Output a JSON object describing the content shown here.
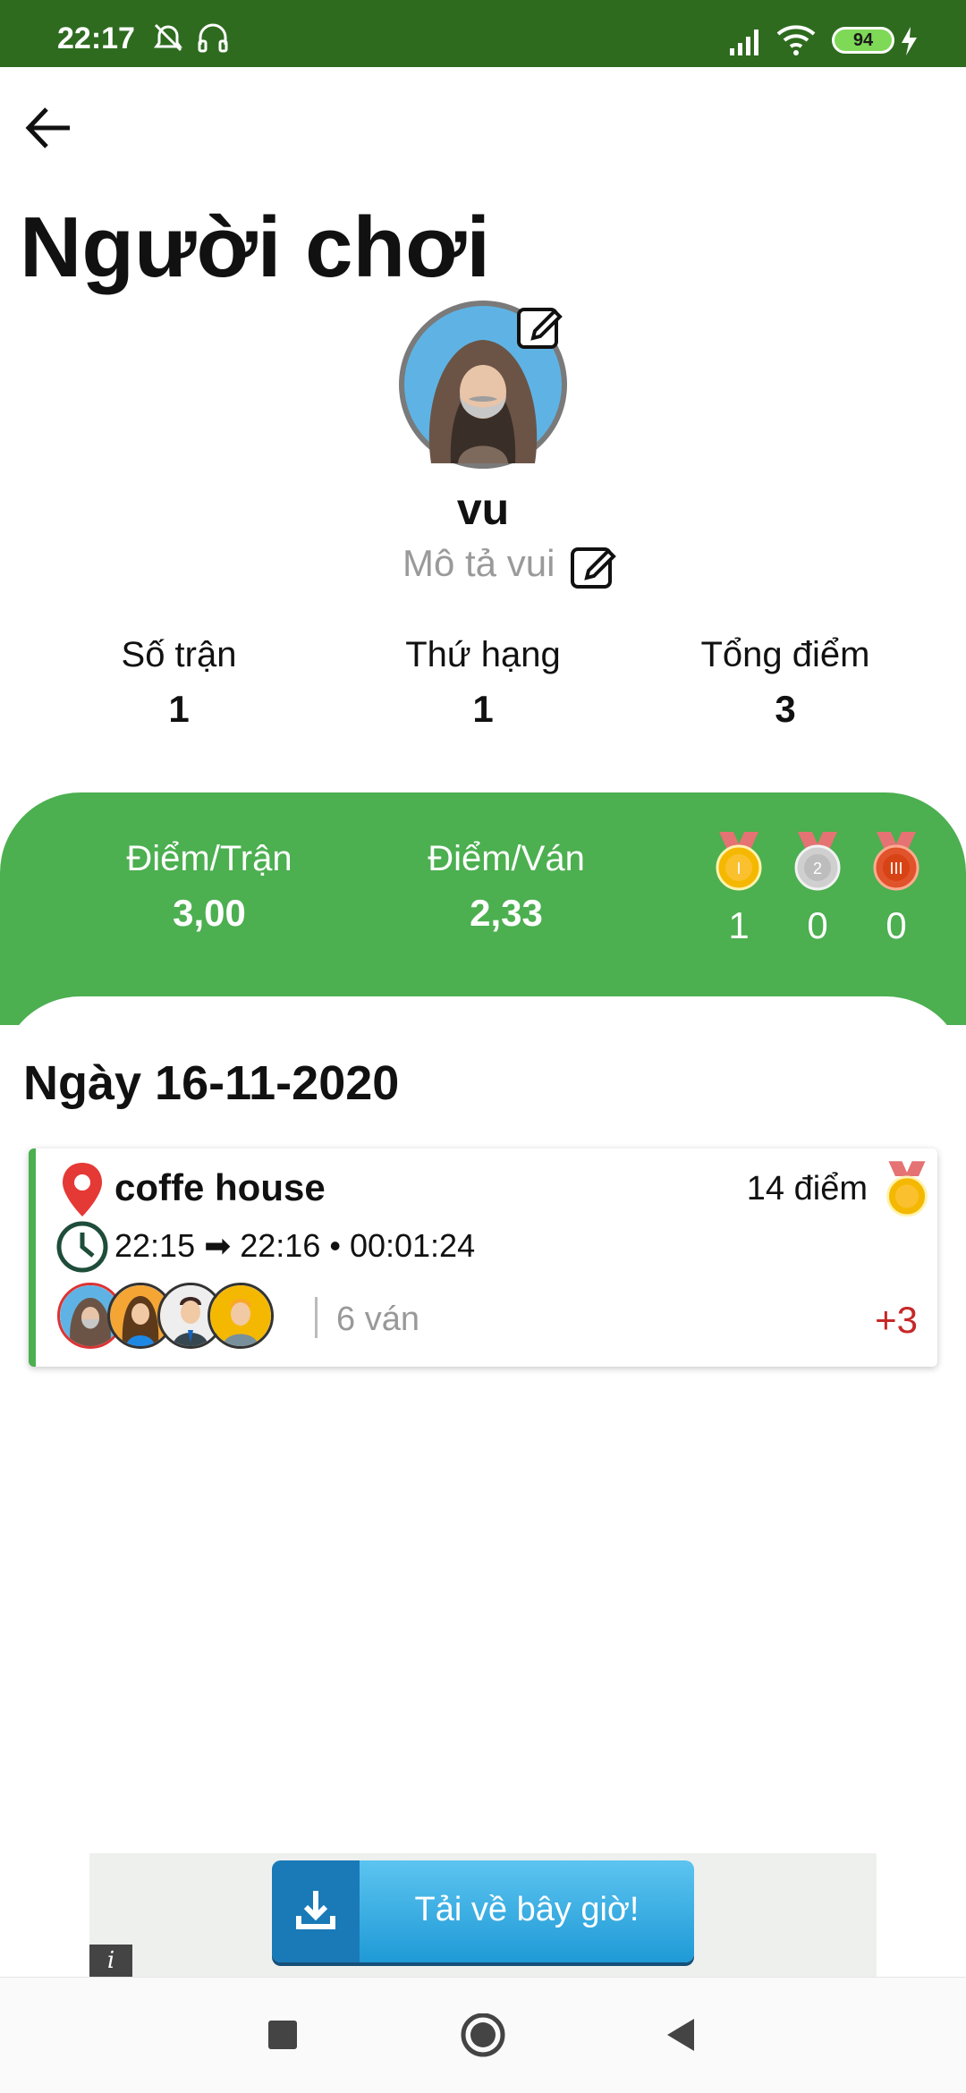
{
  "status_bar": {
    "time": "22:17",
    "battery": "94",
    "icons": [
      "alarm-off-icon",
      "headphones-icon",
      "signal-icon",
      "wifi-icon",
      "battery-icon",
      "charging-icon"
    ]
  },
  "header": {
    "title": "Người chơi",
    "back_icon": "arrow-left-icon"
  },
  "profile": {
    "name": "vu",
    "description": "Mô tả vui",
    "avatar_icon": "hooded-man-avatar",
    "edit_icon": "edit-icon"
  },
  "stats": [
    {
      "label": "Số trận",
      "value": "1"
    },
    {
      "label": "Thứ hạng",
      "value": "1"
    },
    {
      "label": "Tổng điểm",
      "value": "3"
    }
  ],
  "summary": {
    "per_match_label": "Điểm/Trận",
    "per_match_value": "3,00",
    "per_round_label": "Điểm/Ván",
    "per_round_value": "2,33",
    "medals": [
      {
        "type": "gold",
        "count": "1"
      },
      {
        "type": "silver",
        "count": "0"
      },
      {
        "type": "bronze",
        "count": "0"
      }
    ]
  },
  "history": {
    "date_heading": "Ngày 16-11-2020",
    "matches": [
      {
        "location": "coffe house",
        "points": "14 điểm",
        "time_range": "22:15 ➡ 22:16 • 00:01:24",
        "rounds": "6 ván",
        "score_delta": "+3"
      }
    ]
  },
  "ad": {
    "label": "Tải về bây giờ!",
    "info": "i"
  },
  "colors": {
    "accent": "#4caf50",
    "status_bar": "#2e6b1f",
    "negative": "#c62828"
  }
}
